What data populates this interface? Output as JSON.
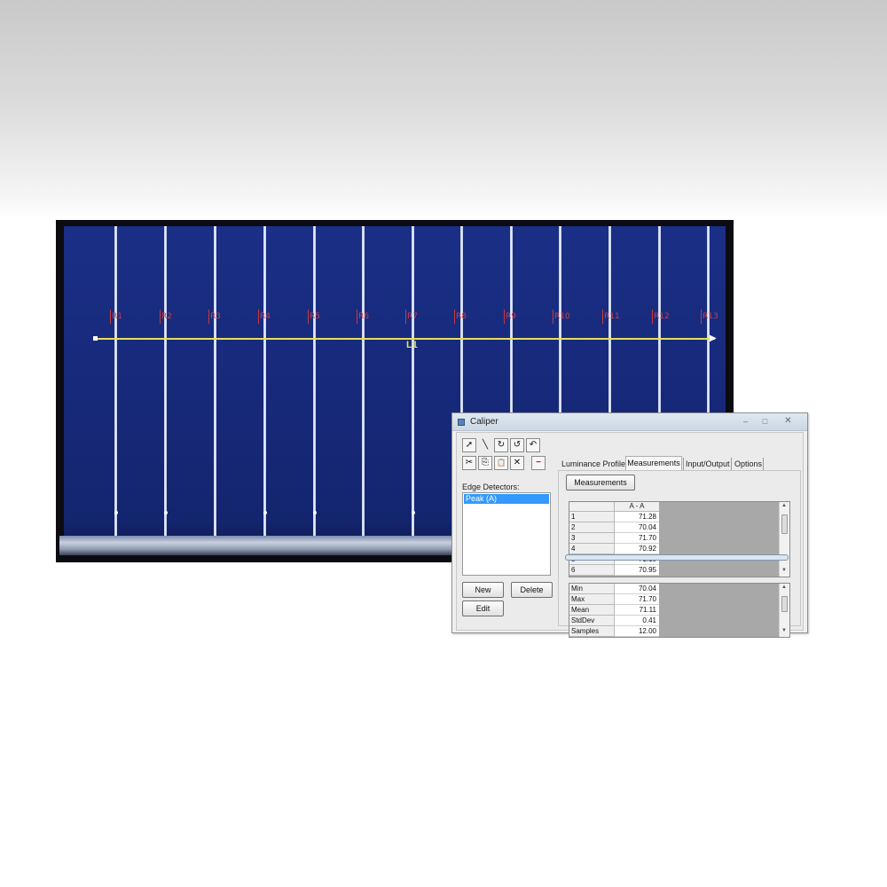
{
  "image": {
    "line_label": "L1",
    "markers": [
      "R1",
      "R2",
      "R3",
      "R4",
      "R5",
      "R6",
      "R7",
      "R8",
      "R9",
      "R10",
      "R11",
      "R12",
      "R13"
    ]
  },
  "window": {
    "title": "Caliper",
    "minimize": "–",
    "maximize": "□",
    "close": "✕"
  },
  "toolbar": {
    "pointer": "➚",
    "line": "╲",
    "rotate_cw": "↻",
    "rotate_ccw": "↺",
    "freehand": "↶",
    "cut": "✂",
    "copy": "⎘",
    "paste": "📋",
    "delete": "✕",
    "remove": "−"
  },
  "edge_detectors": {
    "label": "Edge Detectors:",
    "items": [
      "Peak (A)"
    ],
    "new_button": "New",
    "delete_button": "Delete",
    "edit_button": "Edit"
  },
  "tabs": {
    "luminance_profile": "Luminance Profile",
    "measurements": "Measurements",
    "input_output": "Input/Output",
    "options": "Options"
  },
  "measurements_button": "Measurements",
  "table": {
    "column_header": "A - A",
    "rows": [
      {
        "label": "1",
        "value": "71.28"
      },
      {
        "label": "2",
        "value": "70.04"
      },
      {
        "label": "3",
        "value": "71.70"
      },
      {
        "label": "4",
        "value": "70.92"
      },
      {
        "label": "5",
        "value": "71.10"
      },
      {
        "label": "6",
        "value": "70.95"
      }
    ]
  },
  "stats": {
    "rows": [
      {
        "label": "Min",
        "value": "70.04"
      },
      {
        "label": "Max",
        "value": "71.70"
      },
      {
        "label": "Mean",
        "value": "71.11"
      },
      {
        "label": "StdDev",
        "value": "0.41"
      },
      {
        "label": "Samples",
        "value": "12.00"
      }
    ]
  },
  "colors": {
    "cell_blue": "#17297a",
    "scan_line": "#e5df5a",
    "marker_red": "#d23d3d",
    "selection": "#3399ff"
  }
}
